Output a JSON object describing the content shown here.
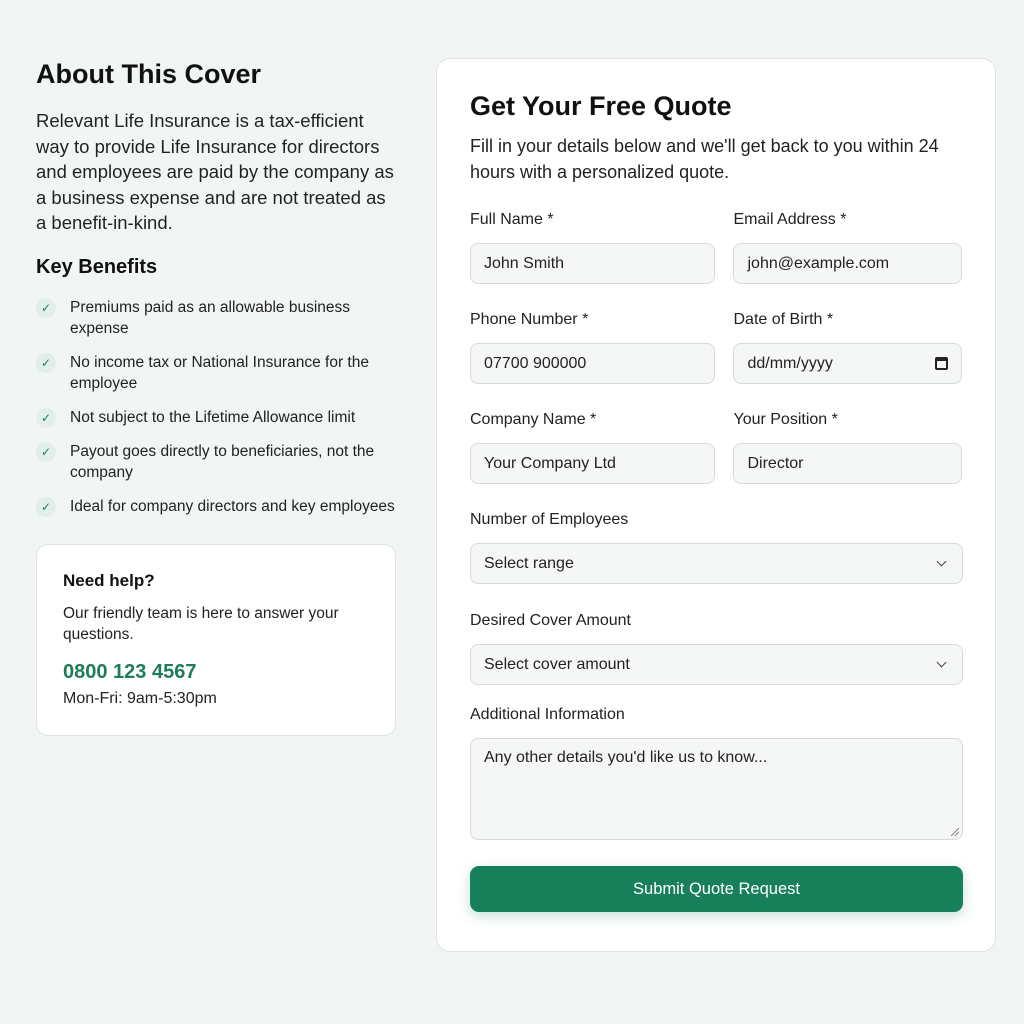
{
  "about": {
    "title": "About This Cover",
    "intro": "Relevant Life Insurance is a tax-efficient way to provide Life Insurance for directors and employees are paid by the company as a business expense and are not treated as a benefit-in-kind.",
    "benefits_title": "Key Benefits",
    "check_glyph": "✓",
    "benefits": [
      "Premiums paid as an allowable business expense",
      "No income tax or National Insurance for the employee",
      "Not subject to the Lifetime Allowance limit",
      "Payout goes directly to beneficiaries, not the company",
      "Ideal for company directors and key employees"
    ]
  },
  "help": {
    "title": "Need help?",
    "text": "Our friendly team is here to answer your questions.",
    "phone": "0800 123 4567",
    "hours": "Mon-Fri: 9am-5:30pm"
  },
  "form": {
    "title": "Get Your Free Quote",
    "subtitle": "Fill in your details below and we'll get back to you within 24 hours with a personalized quote.",
    "full_name": {
      "label": "Full Name *",
      "placeholder": "John Smith"
    },
    "email": {
      "label": "Email Address *",
      "placeholder": "john@example.com"
    },
    "phone": {
      "label": "Phone Number *",
      "placeholder": "07700 900000"
    },
    "dob": {
      "label": "Date of Birth *",
      "placeholder": "dd/mm/yyyy"
    },
    "company": {
      "label": "Company Name *",
      "placeholder": "Your Company Ltd"
    },
    "position": {
      "label": "Your Position *",
      "placeholder": "Director"
    },
    "employees": {
      "label": "Number of Employees",
      "selected": "Select range"
    },
    "cover": {
      "label": "Desired Cover Amount",
      "selected": "Select cover amount"
    },
    "additional": {
      "label": "Additional Information",
      "placeholder": "Any other details you'd like us to know..."
    },
    "submit_label": "Submit Quote Request"
  },
  "colors": {
    "accent": "#17805a",
    "background": "#f1f5f3"
  },
  "icons": {
    "check": "check-icon",
    "calendar": "calendar-icon",
    "select": "chevron-down-icon"
  }
}
